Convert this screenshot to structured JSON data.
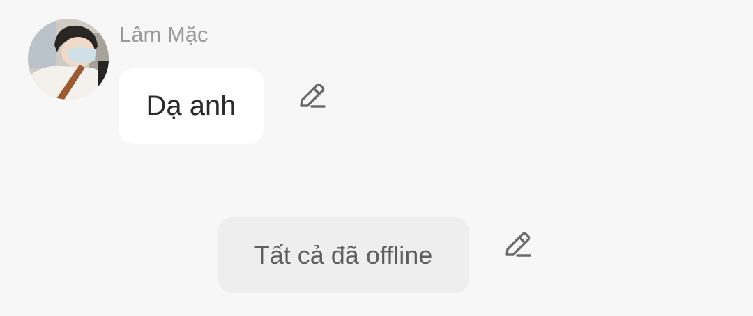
{
  "message": {
    "sender_name": "Lâm Mặc",
    "text": "Dạ anh",
    "avatar_icon": "user-avatar-photo",
    "edit_icon": "pencil-edit-icon"
  },
  "system_notice": {
    "text": "Tất cả đã offline",
    "edit_icon": "pencil-edit-icon"
  },
  "colors": {
    "background": "#f7f7f7",
    "bubble": "#ffffff",
    "system_pill": "#eeeeee",
    "name_text": "#9a9a9a",
    "icon": "#6b6b6b"
  }
}
